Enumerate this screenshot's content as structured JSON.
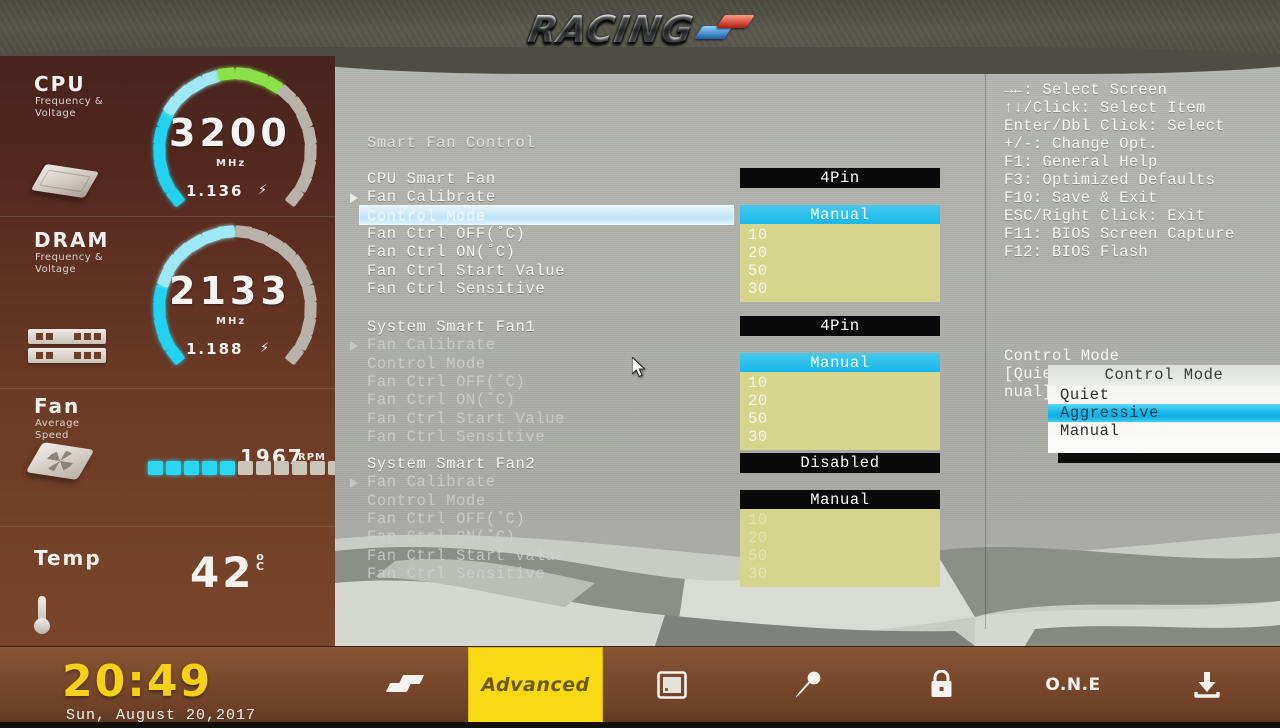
{
  "brand": {
    "logo_text": "RACING",
    "logo_icon": "racing-chevron-logo"
  },
  "sidebar": {
    "cpu": {
      "title": "CPU",
      "subtitle_line1": "Frequency &",
      "subtitle_line2": "Voltage",
      "value": "3200",
      "unit": "MHz",
      "voltage": "1.136",
      "icon": "cpu-chip-icon",
      "gauge_filled": 14,
      "gauge_total": 22,
      "gauge_colors": [
        "#24d2f0",
        "#8ae24a"
      ]
    },
    "dram": {
      "title": "DRAM",
      "subtitle_line1": "Frequency &",
      "subtitle_line2": "Voltage",
      "value": "2133",
      "unit": "MHz",
      "voltage": "1.188",
      "icon": "dram-module-icon",
      "gauge_filled": 11,
      "gauge_total": 22,
      "gauge_colors": [
        "#24d2f0"
      ]
    },
    "fan": {
      "title": "Fan",
      "subtitle_line1": "Average",
      "subtitle_line2": "Speed",
      "value": "1967",
      "unit": "RPM",
      "icon": "fan-icon",
      "bars_filled": 5,
      "bars_total": 13,
      "bar_color": "#2ad6f2"
    },
    "temp": {
      "title": "Temp",
      "value": "42",
      "unit_symbol": "o",
      "unit_letter": "C",
      "icon": "thermometer-icon"
    }
  },
  "main": {
    "section_header": "Smart Fan Control",
    "groups": [
      {
        "name": "cpu-smart-fan",
        "rows": [
          {
            "label": "CPU Smart Fan",
            "arrow": false,
            "dim": false,
            "highlight": false,
            "value": "4Pin",
            "value_style": "black"
          },
          {
            "label": "Fan Calibrate",
            "arrow": true,
            "dim": false,
            "highlight": false,
            "value": "",
            "value_style": "none"
          },
          {
            "label": "Control Mode",
            "arrow": false,
            "dim": false,
            "highlight": true,
            "value": "Manual",
            "value_style": "cyan"
          },
          {
            "label": "Fan Ctrl OFF(˚C)",
            "arrow": false,
            "dim": false,
            "highlight": false,
            "value": "10",
            "value_style": "olive"
          },
          {
            "label": "Fan Ctrl ON(˚C)",
            "arrow": false,
            "dim": false,
            "highlight": false,
            "value": "20",
            "value_style": "olive"
          },
          {
            "label": "Fan Ctrl Start Value",
            "arrow": false,
            "dim": false,
            "highlight": false,
            "value": "50",
            "value_style": "olive"
          },
          {
            "label": "Fan Ctrl Sensitive",
            "arrow": false,
            "dim": false,
            "highlight": false,
            "value": "30",
            "value_style": "olive"
          }
        ]
      },
      {
        "name": "system-smart-fan1",
        "rows": [
          {
            "label": "System Smart Fan1",
            "arrow": false,
            "dim": false,
            "highlight": false,
            "value": "4Pin",
            "value_style": "black"
          },
          {
            "label": "Fan Calibrate",
            "arrow": true,
            "dim": true,
            "highlight": false,
            "value": "",
            "value_style": "none"
          },
          {
            "label": "Control Mode",
            "arrow": false,
            "dim": true,
            "highlight": false,
            "value": "Manual",
            "value_style": "cyan"
          },
          {
            "label": "Fan Ctrl OFF(˚C)",
            "arrow": false,
            "dim": true,
            "highlight": false,
            "value": "10",
            "value_style": "olive"
          },
          {
            "label": "Fan Ctrl ON(˚C)",
            "arrow": false,
            "dim": true,
            "highlight": false,
            "value": "20",
            "value_style": "olive"
          },
          {
            "label": "Fan Ctrl Start Value",
            "arrow": false,
            "dim": true,
            "highlight": false,
            "value": "50",
            "value_style": "olive"
          },
          {
            "label": "Fan Ctrl Sensitive",
            "arrow": false,
            "dim": true,
            "highlight": false,
            "value": "30",
            "value_style": "olive"
          }
        ]
      },
      {
        "name": "system-smart-fan2",
        "rows": [
          {
            "label": "System Smart Fan2",
            "arrow": false,
            "dim": false,
            "highlight": false,
            "value": "Disabled",
            "value_style": "black"
          },
          {
            "label": "Fan Calibrate",
            "arrow": true,
            "dim": true,
            "highlight": false,
            "value": "",
            "value_style": "none"
          },
          {
            "label": "Control Mode",
            "arrow": false,
            "dim": true,
            "highlight": false,
            "value": "Manual",
            "value_style": "black"
          },
          {
            "label": "Fan Ctrl OFF(˚C)",
            "arrow": false,
            "dim": true,
            "highlight": false,
            "value": "10",
            "value_style": "olive-dim"
          },
          {
            "label": "Fan Ctrl ON(˚C)",
            "arrow": false,
            "dim": true,
            "highlight": false,
            "value": "20",
            "value_style": "olive-dim"
          },
          {
            "label": "Fan Ctrl Start Value",
            "arrow": false,
            "dim": true,
            "highlight": false,
            "value": "50",
            "value_style": "olive-dim"
          },
          {
            "label": "Fan Ctrl Sensitive",
            "arrow": false,
            "dim": true,
            "highlight": false,
            "value": "30",
            "value_style": "olive-dim"
          }
        ]
      }
    ]
  },
  "dropdown": {
    "title": "Control Mode",
    "options": [
      "Quiet",
      "Aggressive",
      "Manual"
    ],
    "selected_index": 1
  },
  "help": {
    "keys": [
      "→←: Select Screen",
      "↑↓/Click: Select Item",
      "Enter/Dbl Click: Select",
      "+/-: Change Opt.",
      "F1: General Help",
      "F3: Optimized Defaults",
      "F10: Save & Exit",
      "ESC/Right Click: Exit",
      "F11: BIOS Screen Capture",
      "F12: BIOS Flash"
    ],
    "description_line1": "Control Mode",
    "description_line2": "[Quiet]/[Aggressive]/[Ma",
    "description_line3": "nual]"
  },
  "bottom": {
    "time": "20:49",
    "date": "Sun,  August  20,2017",
    "nav": [
      {
        "name": "home-chevron",
        "label": "",
        "icon": "racing-chevron-icon",
        "active": false
      },
      {
        "name": "advanced",
        "label": "Advanced",
        "icon": "",
        "active": true
      },
      {
        "name": "monitor",
        "label": "",
        "icon": "monitor-icon",
        "active": false
      },
      {
        "name": "tweaker",
        "label": "",
        "icon": "screwdriver-icon",
        "active": false
      },
      {
        "name": "security",
        "label": "",
        "icon": "lock-icon",
        "active": false
      },
      {
        "name": "one",
        "label": "O.N.E",
        "icon": "",
        "active": false
      },
      {
        "name": "save-exit",
        "label": "",
        "icon": "download-save-icon",
        "active": false
      }
    ]
  },
  "colors": {
    "accent_cyan": "#15b7e8",
    "accent_yellow": "#f8d914",
    "olive_value": "#d6d58c",
    "sidebar_brown": "#6b3a26"
  }
}
